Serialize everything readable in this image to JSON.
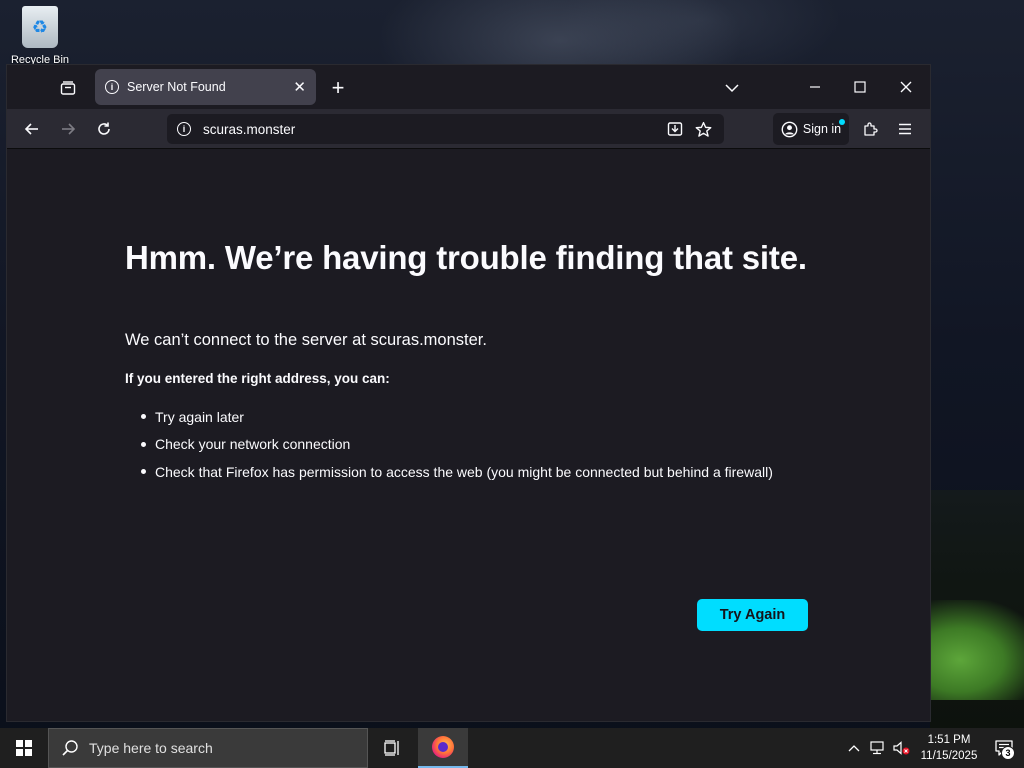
{
  "desktop": {
    "recycle_bin_label": "Recycle Bin"
  },
  "browser": {
    "tab": {
      "title": "Server Not Found"
    },
    "url": "scuras.monster",
    "sign_in_label": "Sign in",
    "accent_color": "#00ddff"
  },
  "page": {
    "title": "Hmm. We’re having trouble finding that site.",
    "description": "We can’t connect to the server at scuras.monster.",
    "lead": "If you entered the right address, you can:",
    "suggestions": [
      "Try again later",
      "Check your network connection",
      "Check that Firefox has permission to access the web (you might be connected but behind a firewall)"
    ],
    "try_again_label": "Try Again"
  },
  "taskbar": {
    "search_placeholder": "Type here to search",
    "time": "1:51 PM",
    "date": "11/15/2025",
    "notification_count": "3"
  }
}
